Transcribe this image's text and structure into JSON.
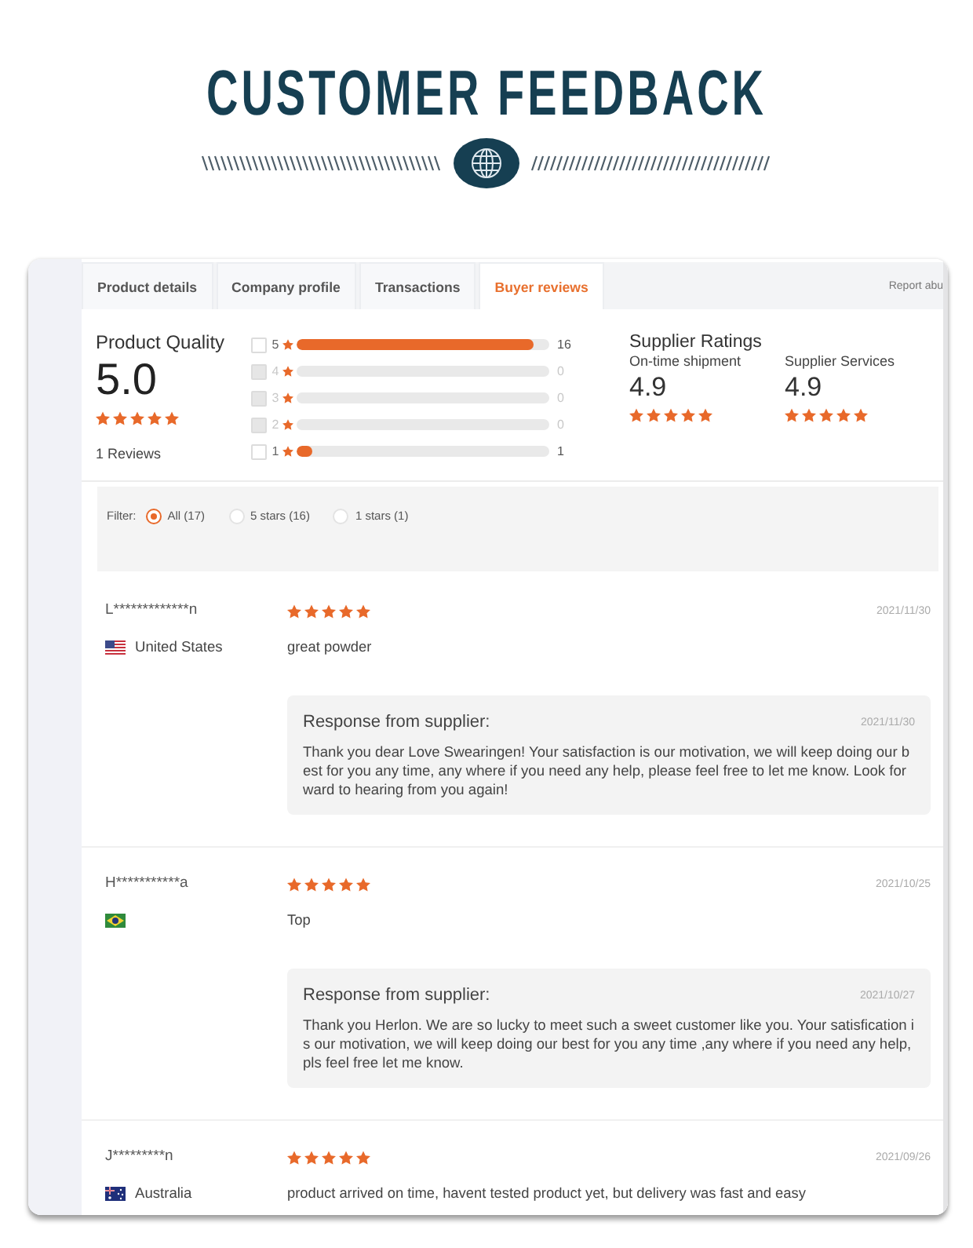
{
  "header": {
    "title": "CUSTOMER FEEDBACK"
  },
  "tabs": [
    {
      "label": "Product details",
      "selected": false
    },
    {
      "label": "Company profile",
      "selected": false
    },
    {
      "label": "Transactions",
      "selected": false
    },
    {
      "label": "Buyer reviews",
      "selected": true
    }
  ],
  "report_link": "Report abu",
  "product_quality": {
    "title": "Product Quality",
    "score": "5.0",
    "stars": 5,
    "review_count": "1 Reviews"
  },
  "breakdown": [
    {
      "label": "5",
      "checked": false,
      "disabled": false,
      "level": 0.94,
      "count": "16"
    },
    {
      "label": "4",
      "checked": false,
      "disabled": true,
      "count": "0"
    },
    {
      "label": "3",
      "checked": false,
      "disabled": true,
      "count": "0"
    },
    {
      "label": "2",
      "checked": false,
      "disabled": true,
      "count": "0"
    },
    {
      "label": "1",
      "checked": false,
      "disabled": false,
      "level": 0.06,
      "count": "1"
    }
  ],
  "supplier_ratings": {
    "title": "Supplier Ratings",
    "items": [
      {
        "label": "On-time shipment",
        "score": "4.9",
        "stars": 5
      },
      {
        "label": "Supplier Services",
        "score": "4.9",
        "stars": 5
      }
    ]
  },
  "filter": {
    "label": "Filter:",
    "options": [
      {
        "label": "All (17)",
        "selected": true
      },
      {
        "label": "5 stars (16)",
        "selected": false
      },
      {
        "label": "1 stars (1)",
        "selected": false
      }
    ]
  },
  "reviews": [
    {
      "name": "L*************n",
      "flag": {
        "kind": "us"
      },
      "country": "United States",
      "stars": 5,
      "date": "2021/11/30",
      "comment": "great powder",
      "response": {
        "title": "Response from supplier:",
        "date": "2021/11/30",
        "text": "Thank you dear Love Swearingen! Your satisfaction is our motivation, we will keep doing our best for you any time, any where if you need any help, please feel free to let me know. Look forward to hearing from you again!"
      }
    },
    {
      "name": "H***********a",
      "flag": {
        "kind": "brazil"
      },
      "stars": 5,
      "date": "2021/10/25",
      "comment": "Top",
      "response": {
        "title": "Response from supplier:",
        "date": "2021/10/27",
        "text": "Thank you Herlon. We are so lucky to meet such a sweet customer like you. Your satisfication is our motivation, we will keep doing our best for you any time ,any where if you need any help, pls feel free let me know."
      }
    },
    {
      "name": "J*********n",
      "flag": {
        "kind": "australia"
      },
      "country": "Australia",
      "stars": 5,
      "date": "2021/09/26",
      "comment": "product arrived on time, havent tested product yet, but delivery was fast and easy"
    }
  ]
}
